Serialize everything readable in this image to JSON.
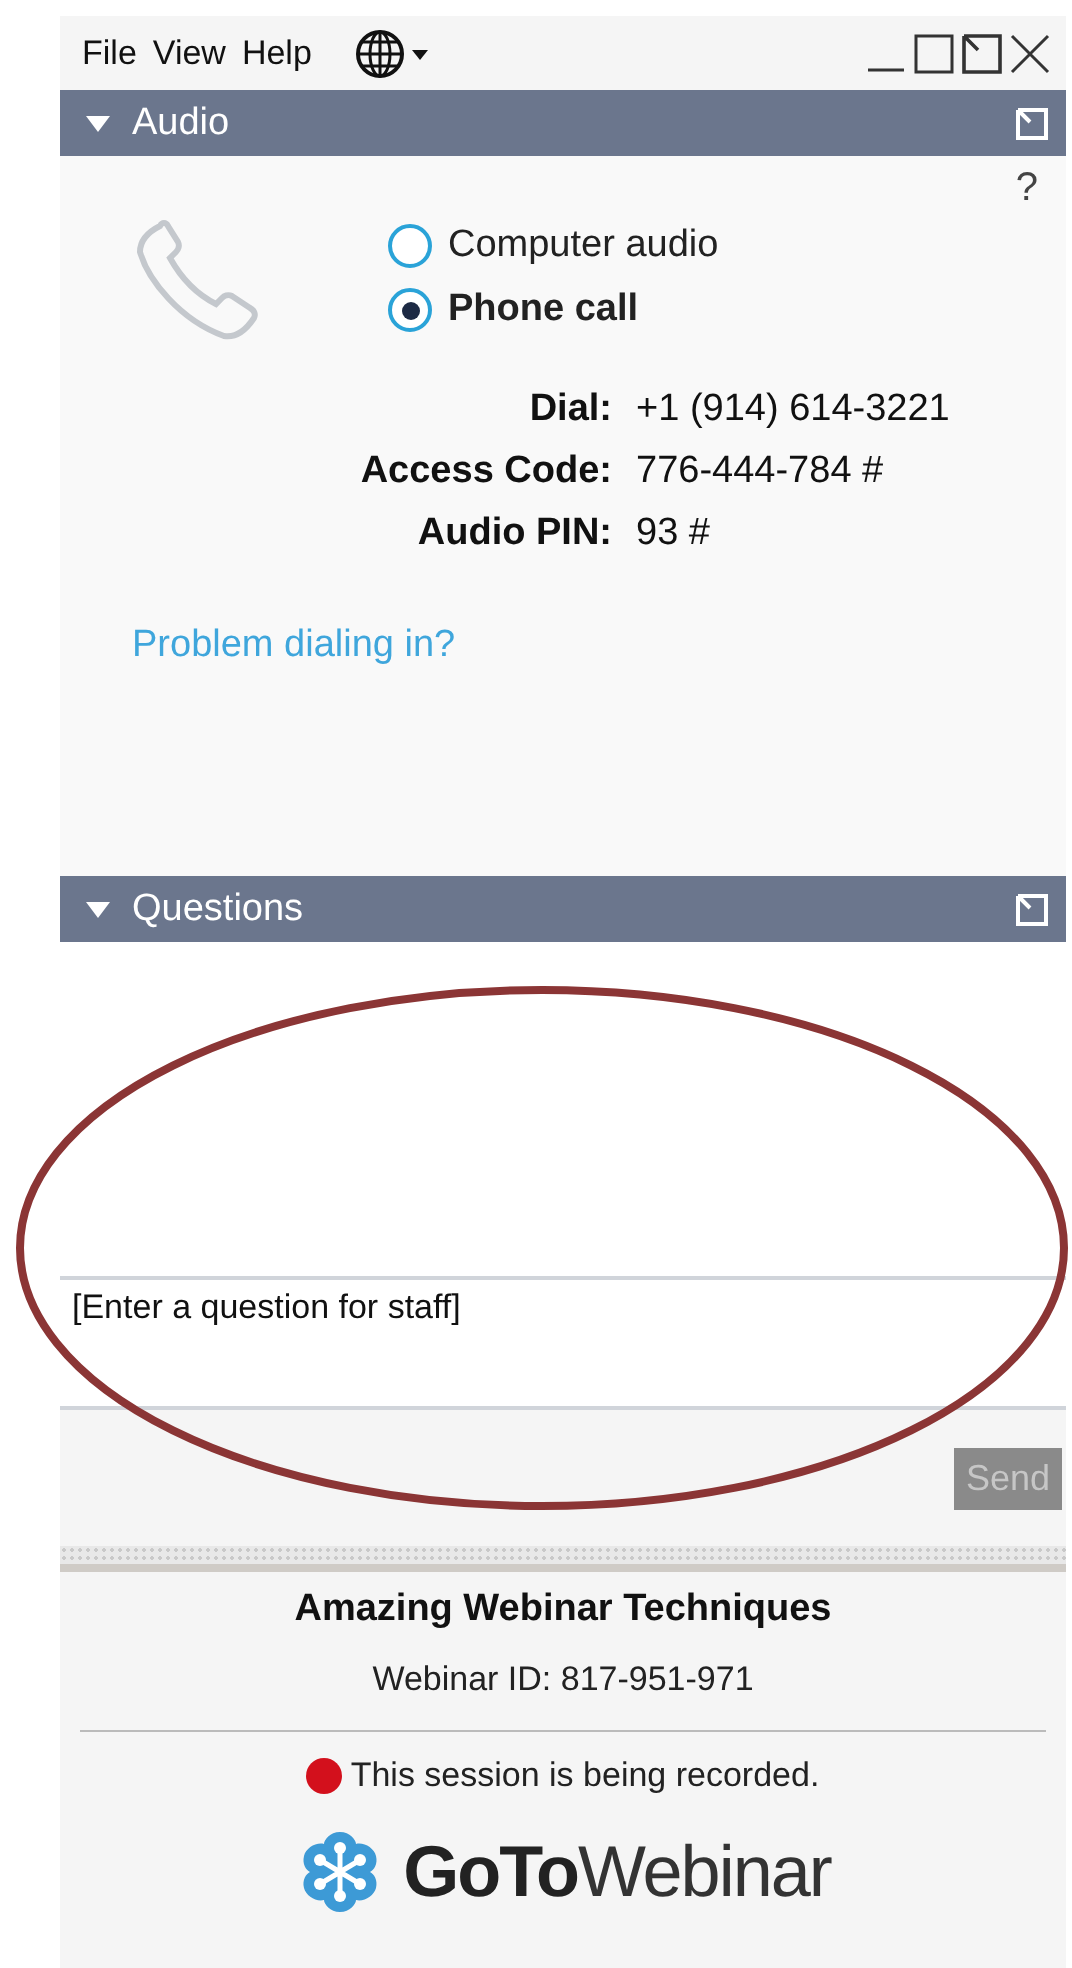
{
  "menu": [
    "File",
    "View",
    "Help"
  ],
  "audio": {
    "title": "Audio",
    "expanded": true,
    "help": "?",
    "options": [
      {
        "label": "Computer audio",
        "selected": false
      },
      {
        "label": "Phone call",
        "selected": true
      }
    ],
    "details": [
      {
        "label": "Dial:",
        "value": "+1 (914) 614-3221"
      },
      {
        "label": "Access Code:",
        "value": "776-444-784 #"
      },
      {
        "label": "Audio PIN:",
        "value": "93 #"
      }
    ],
    "link": "Problem dialing in?"
  },
  "questions": {
    "title": "Questions",
    "expanded": true,
    "placeholder": "[Enter a question for staff]",
    "send": {
      "label": "Send",
      "disabled": true
    }
  },
  "footer": {
    "title": "Amazing Webinar Techniques",
    "webinar_id": "Webinar ID: 817-951-971",
    "recording": "This session is being recorded.",
    "logo": "**GoTo**Webinar"
  }
}
